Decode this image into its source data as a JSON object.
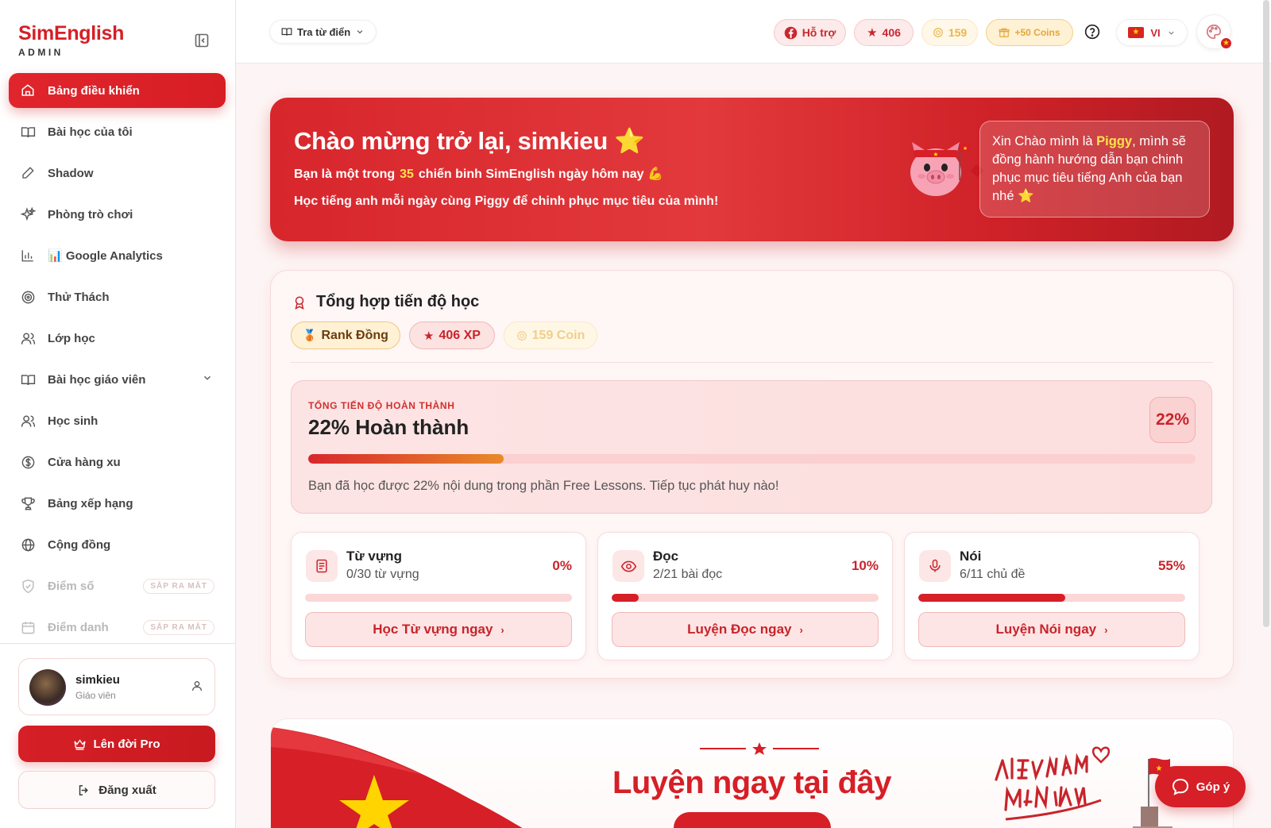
{
  "sidebar": {
    "brand": "SimEnglish",
    "brand_sub": "ADMIN",
    "items": [
      {
        "label": "Bảng điều khiển",
        "icon": "home-icon"
      },
      {
        "label": "Bài học của tôi",
        "icon": "book-open-icon"
      },
      {
        "label": "Shadow",
        "icon": "pen-icon"
      },
      {
        "label": "Phòng trò chơi",
        "icon": "sparkles-icon"
      },
      {
        "label": "📊 Google Analytics",
        "icon": "bar-chart-icon"
      },
      {
        "label": "Thử Thách",
        "icon": "target-icon"
      },
      {
        "label": "Lớp học",
        "icon": "users-icon"
      },
      {
        "label": "Bài học giáo viên",
        "icon": "book-open-icon"
      },
      {
        "label": "Học sinh",
        "icon": "users-icon"
      },
      {
        "label": "Cửa hàng xu",
        "icon": "dollar-circle-icon"
      },
      {
        "label": "Bảng xếp hạng",
        "icon": "trophy-icon"
      },
      {
        "label": "Cộng đồng",
        "icon": "globe-icon"
      },
      {
        "label": "Điểm số",
        "icon": "shield-icon"
      },
      {
        "label": "Điểm danh",
        "icon": "calendar-icon"
      }
    ],
    "soon_label": "SẮP RA MẮT",
    "user": {
      "name": "simkieu",
      "role": "Giáo viên"
    },
    "pro_label": "Lên đời Pro",
    "logout_label": "Đăng xuất"
  },
  "topbar": {
    "dict_label": "Tra từ điển",
    "help_label": "Hỗ trợ",
    "xp": "406",
    "coins": "159",
    "bonus": "+50 Coins",
    "lang": "VI"
  },
  "hero": {
    "title": "Chào mừng trở lại, simkieu ⭐",
    "line1_pre": "Bạn là một trong",
    "line1_num": "35",
    "line1_post": "chiến binh SimEnglish ngày hôm nay 💪",
    "line2": "Học tiếng anh mỗi ngày cùng Piggy để chinh phục mục tiêu của mình!",
    "bubble_pre": "Xin Chào mình là ",
    "bubble_name": "Piggy",
    "bubble_post": ", mình sẽ đồng hành hướng dẫn bạn chinh phục mục tiêu tiếng Anh của bạn nhé ⭐"
  },
  "progress": {
    "title": "Tổng hợp tiến độ học",
    "rank": "Rank Đồng",
    "xp": "406 XP",
    "coin": "159 Coin",
    "overall_label": "TỔNG TIẾN ĐỘ HOÀN THÀNH",
    "overall_title": "22% Hoàn thành",
    "overall_pct": "22%",
    "overall_value": 0.22,
    "overall_desc": "Bạn đã học được 22% nội dung trong phần Free Lessons. Tiếp tục phát huy nào!",
    "skills": [
      {
        "name": "Từ vựng",
        "sub": "0/30 từ vựng",
        "pct": "0%",
        "value": 0.0,
        "button": "Học Từ vựng ngay",
        "icon": "document-icon"
      },
      {
        "name": "Đọc",
        "sub": "2/21 bài đọc",
        "pct": "10%",
        "value": 0.1,
        "button": "Luyện Đọc ngay",
        "icon": "eye-icon"
      },
      {
        "name": "Nói",
        "sub": "6/11 chủ đề",
        "pct": "55%",
        "value": 0.55,
        "button": "Luyện Nói ngay",
        "icon": "microphone-icon"
      }
    ]
  },
  "practice": {
    "title": "Luyện ngay tại đây"
  },
  "feedback_label": "Góp ý",
  "colors": {
    "brand": "#d61f26",
    "accent_gold": "#ffe14a",
    "coin": "#e7b74a"
  }
}
